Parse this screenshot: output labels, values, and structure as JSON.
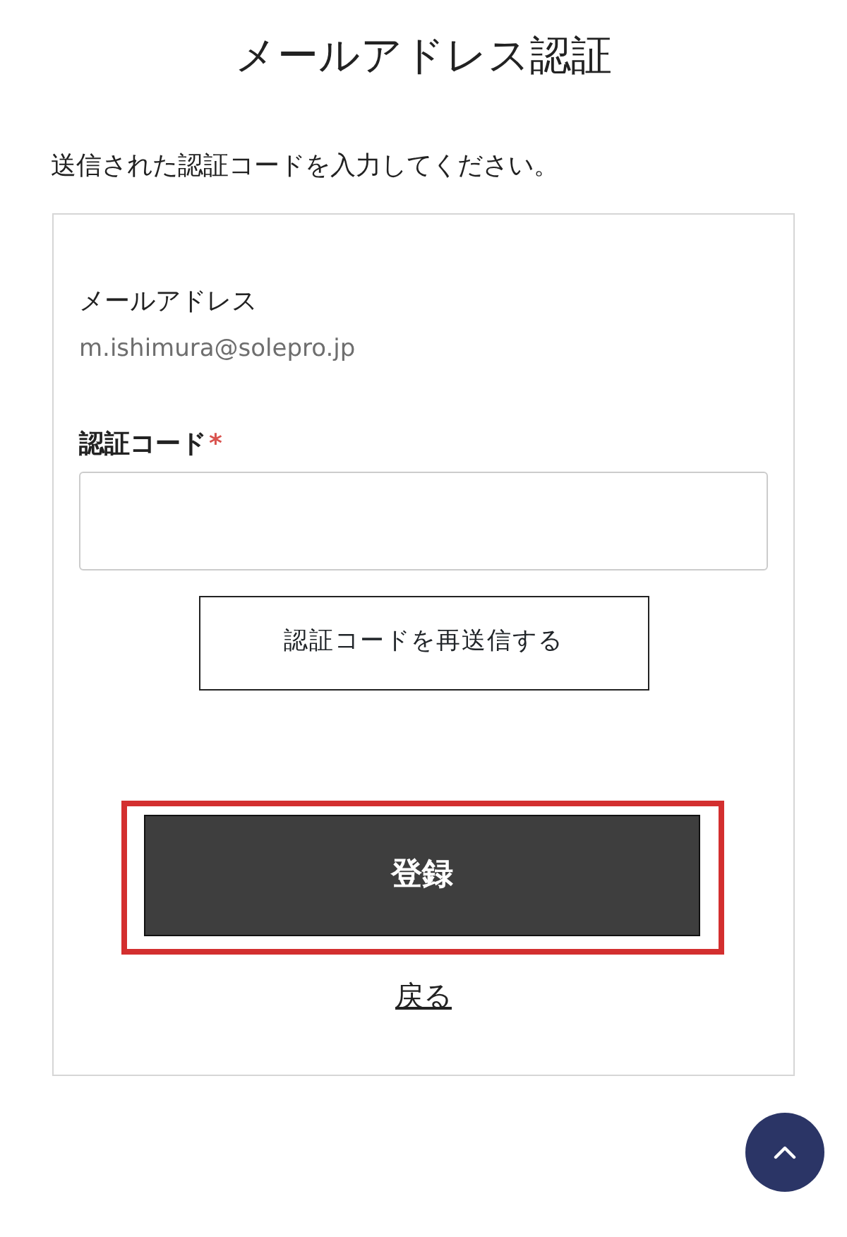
{
  "title": "メールアドレス認証",
  "instruction": "送信された認証コードを入力してください。",
  "email": {
    "label": "メールアドレス",
    "value": "m.ishimura@solepro.jp"
  },
  "code_field": {
    "label": "認証コード",
    "required_mark": "*",
    "required": true
  },
  "resend_button": "認証コードを再送信する",
  "submit_button": {
    "label": "登録",
    "highlighted": true
  },
  "back_link": "戻る",
  "scroll_top": {
    "visible": true
  }
}
